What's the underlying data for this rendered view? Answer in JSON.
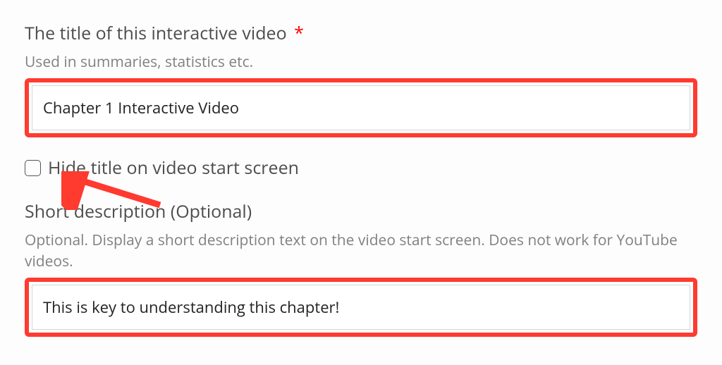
{
  "fields": {
    "title": {
      "label": "The title of this interactive video",
      "required_marker": "*",
      "hint": "Used in summaries, statistics etc.",
      "value": "Chapter 1 Interactive Video"
    },
    "hideTitle": {
      "label": "Hide title on video start screen",
      "checked": false
    },
    "shortDescription": {
      "label": "Short description (Optional)",
      "hint": "Optional. Display a short description text on the video start screen. Does not work for YouTube videos.",
      "value": "This is key to understanding this chapter!"
    }
  },
  "annotation": {
    "highlight_color": "#ff3a2f"
  }
}
